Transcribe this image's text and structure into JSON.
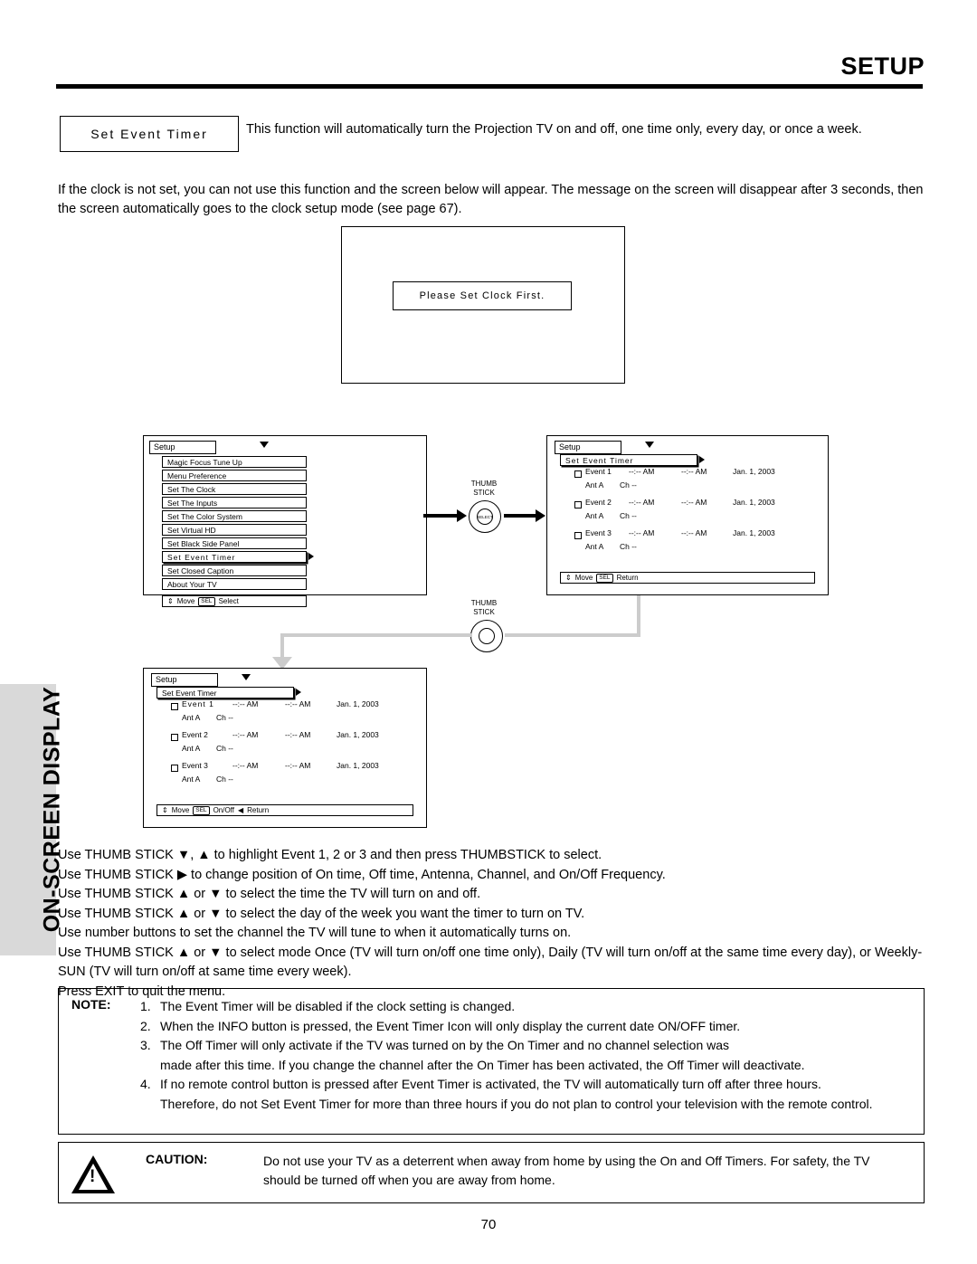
{
  "header": {
    "title": "SETUP"
  },
  "side_band": {
    "label": "ON-SCREEN DISPLAY"
  },
  "feature": {
    "title": "Set Event Timer",
    "description": "This function will automatically turn the Projection TV on and off, one time only, every day, or once a week.",
    "intro": "If the clock is not set, you can not use this function and the screen below will appear.  The message on the screen will disappear after 3 seconds, then the screen automatically goes to the clock setup mode (see page 67)."
  },
  "tv_screen": {
    "message": "Please Set Clock First."
  },
  "osd_main": {
    "title": "Setup",
    "items": [
      "Magic Focus Tune Up",
      "Menu Preference",
      "Set The Clock",
      "Set The Inputs",
      "Set The Color System",
      "Set Virtual HD",
      "Set Black Side Panel",
      "Set Event Timer",
      "Set Closed Caption",
      "About Your TV"
    ],
    "selected": "Set Event Timer",
    "bottom": {
      "move": "Move",
      "chip": "SEL",
      "action": "Select"
    }
  },
  "osd_timer_right": {
    "title": "Setup",
    "subtitle": "Set Event Timer",
    "rows": [
      {
        "label": "Event 1",
        "time": "--:-- AM",
        "offtime": "--:-- AM",
        "date": "Jan. 1, 2003",
        "ant": "Ant A",
        "ch": "Ch --"
      },
      {
        "label": "Event 2",
        "time": "--:-- AM",
        "offtime": "--:-- AM",
        "date": "Jan. 1, 2003",
        "ant": "Ant A",
        "ch": "Ch --"
      },
      {
        "label": "Event 3",
        "time": "--:-- AM",
        "offtime": "--:-- AM",
        "date": "Jan. 1, 2003",
        "ant": "Ant A",
        "ch": "Ch --"
      }
    ],
    "bottom": {
      "move": "Move",
      "chip": "SEL",
      "action": "Return"
    }
  },
  "osd_timer_bottom": {
    "title": "Setup",
    "subtitle": "Set Event Timer",
    "rows": [
      {
        "label": "Event 1",
        "time": "--:-- AM",
        "offtime": "--:-- AM",
        "date": "Jan. 1, 2003",
        "ant": "Ant A",
        "ch": "Ch --"
      },
      {
        "label": "Event 2",
        "time": "--:-- AM",
        "offtime": "--:-- AM",
        "date": "Jan. 1, 2003",
        "ant": "Ant A",
        "ch": "Ch --"
      },
      {
        "label": "Event 3",
        "time": "--:-- AM",
        "offtime": "--:-- AM",
        "date": "Jan. 1, 2003",
        "ant": "Ant A",
        "ch": "Ch --"
      }
    ],
    "bottom": {
      "move": "Move",
      "chip": "SEL",
      "action": "On/Off",
      "return": "Return"
    }
  },
  "thumbstick": {
    "label_top": "THUMB",
    "label_bottom": "STICK",
    "select_text": "SELECT"
  },
  "instructions": [
    "Use THUMB STICK ▼, ▲ to highlight Event 1, 2 or 3 and then press THUMBSTICK to select.",
    "Use THUMB STICK ▶ to change position of On time, Off time, Antenna, Channel, and On/Off Frequency.",
    "Use THUMB STICK ▲ or ▼ to select the time the TV will turn on and off.",
    "Use THUMB STICK ▲ or ▼ to select the day of the week you want the timer to turn on TV.",
    "Use number buttons to set the channel the TV will tune to when it automatically turns on.",
    "Use THUMB STICK ▲ or ▼ to select mode Once (TV will turn on/off one time only), Daily (TV will turn on/off at the same time every day), or Weekly-SUN (TV will turn on/off at same time every week).",
    "Press EXIT to quit the menu."
  ],
  "note": {
    "label": "NOTE:",
    "items": [
      {
        "num": "1.",
        "text": "The Event Timer will be disabled if the clock setting is changed."
      },
      {
        "num": "2.",
        "text": "When the INFO button is pressed, the Event Timer Icon will only display the current date ON/OFF timer."
      },
      {
        "num": "3.",
        "text": "The Off Timer will only activate if the TV was turned on by the On Timer and no channel selection was",
        "cont": "made after this time.  If you change the channel after the On Timer has been activated, the Off Timer will deactivate."
      },
      {
        "num": "4.",
        "text": "If no remote control button is pressed after Event Timer is activated, the TV will automatically turn off after three hours.",
        "cont": "Therefore, do not Set Event Timer for more than three hours if you do not plan to control your television with the remote control."
      }
    ]
  },
  "caution": {
    "label": "CAUTION:",
    "text": "Do not use your TV as a deterrent when away from home by using the On and Off Timers.  For safety, the TV should be turned off when you are away from home.",
    "icon": "!"
  },
  "page_number": "70"
}
